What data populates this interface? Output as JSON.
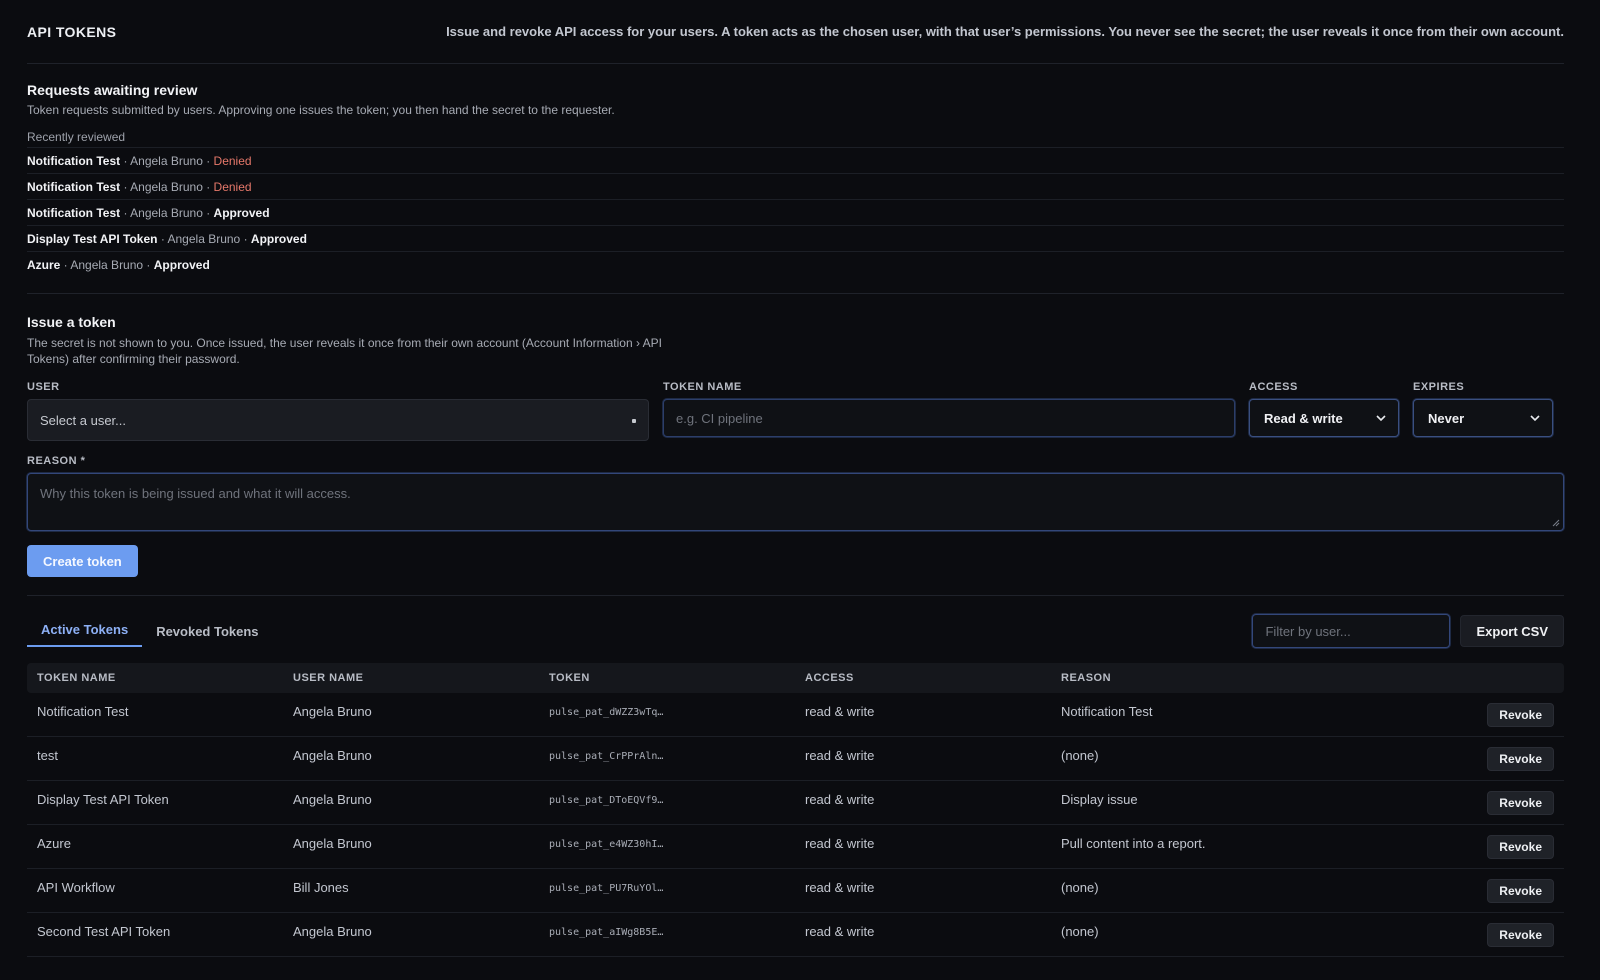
{
  "header": {
    "title": "API TOKENS",
    "description": "Issue and revoke API access for your users. A token acts as the chosen user, with that user’s permissions. You never see the secret; the user reveals it once from their own account."
  },
  "requests": {
    "title": "Requests awaiting review",
    "description": "Token requests submitted by users. Approving one issues the token; you then hand the secret to the requester.",
    "recent_label": "Recently reviewed",
    "items": [
      {
        "name": "Notification Test",
        "user": "Angela Bruno",
        "status": "Denied"
      },
      {
        "name": "Notification Test",
        "user": "Angela Bruno",
        "status": "Denied"
      },
      {
        "name": "Notification Test",
        "user": "Angela Bruno",
        "status": "Approved"
      },
      {
        "name": "Display Test API Token",
        "user": "Angela Bruno",
        "status": "Approved"
      },
      {
        "name": "Azure",
        "user": "Angela Bruno",
        "status": "Approved"
      }
    ],
    "separator": " · "
  },
  "issue": {
    "title": "Issue a token",
    "description": "The secret is not shown to you. Once issued, the user reveals it once from their own account (Account Information › API Tokens) after confirming their password.",
    "user_label": "USER",
    "user_value": "Select a user...",
    "token_name_label": "TOKEN NAME",
    "token_name_placeholder": "e.g. CI pipeline",
    "access_label": "ACCESS",
    "access_value": "Read & write",
    "expires_label": "EXPIRES",
    "expires_value": "Never",
    "reason_label": "REASON *",
    "reason_placeholder": "Why this token is being issued and what it will access.",
    "create_label": "Create token"
  },
  "tabs": [
    {
      "label": "Active Tokens",
      "active": true
    },
    {
      "label": "Revoked Tokens",
      "active": false
    }
  ],
  "toolbar": {
    "filter_placeholder": "Filter by user...",
    "export_label": "Export CSV"
  },
  "table": {
    "headers": [
      "TOKEN NAME",
      "USER NAME",
      "TOKEN",
      "ACCESS",
      "REASON"
    ],
    "revoke_label": "Revoke",
    "rows": [
      {
        "name": "Notification Test",
        "user": "Angela Bruno",
        "token": "pulse_pat_dWZZ3wTq…",
        "access": "read & write",
        "reason": "Notification Test"
      },
      {
        "name": "test",
        "user": "Angela Bruno",
        "token": "pulse_pat_CrPPrAln…",
        "access": "read & write",
        "reason": "(none)"
      },
      {
        "name": "Display Test API Token",
        "user": "Angela Bruno",
        "token": "pulse_pat_DToEQVf9…",
        "access": "read & write",
        "reason": "Display issue"
      },
      {
        "name": "Azure",
        "user": "Angela Bruno",
        "token": "pulse_pat_e4WZ30hI…",
        "access": "read & write",
        "reason": "Pull content into a report."
      },
      {
        "name": "API Workflow",
        "user": "Bill Jones",
        "token": "pulse_pat_PU7RuYOl…",
        "access": "read & write",
        "reason": "(none)"
      },
      {
        "name": "Second Test API Token",
        "user": "Angela Bruno",
        "token": "pulse_pat_aIWg8B5E…",
        "access": "read & write",
        "reason": "(none)"
      }
    ]
  },
  "colors": {
    "accent": "#6c9cf0",
    "denied": "#e6786a",
    "background": "#0b0c10"
  }
}
